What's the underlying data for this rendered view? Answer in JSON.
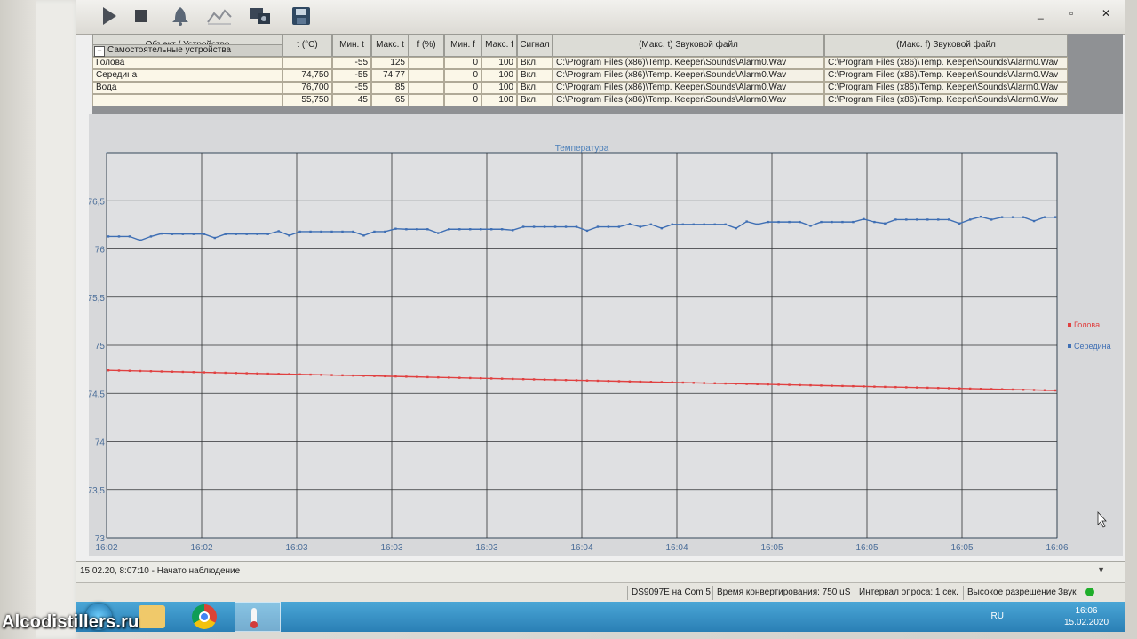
{
  "toolbar": {
    "buttons": [
      {
        "name": "play-icon"
      },
      {
        "name": "stop-icon"
      },
      {
        "name": "bell-icon"
      },
      {
        "name": "chart-icon"
      },
      {
        "name": "devices-icon"
      },
      {
        "name": "save-icon"
      }
    ],
    "window_controls": [
      "_",
      "▫",
      "✕"
    ]
  },
  "table": {
    "group_label": "Самостоятельные устройства",
    "headers": {
      "object": "Объект / Устройство",
      "t": "t (°C)",
      "min_t": "Мин. t",
      "max_t": "Макс. t",
      "f": "f (%)",
      "min_f": "Мин. f",
      "max_f": "Макс. f",
      "signal": "Сигнал",
      "sound_t": "(Макс. t) Звуковой файл",
      "sound_f": "(Макс. f) Звуковой файл"
    },
    "rows": [
      {
        "name": "Голова",
        "t": "",
        "min_t": "-55",
        "max_t": "125",
        "f": "",
        "min_f": "0",
        "max_f": "100",
        "signal": "Вкл.",
        "sound_t": "C:\\Program Files (x86)\\Temp. Keeper\\Sounds\\Alarm0.Wav",
        "sound_f": "C:\\Program Files (x86)\\Temp. Keeper\\Sounds\\Alarm0.Wav"
      },
      {
        "name": "Середина",
        "t": "74,750",
        "min_t": "-55",
        "max_t": "74,77",
        "f": "",
        "min_f": "0",
        "max_f": "100",
        "signal": "Вкл.",
        "sound_t": "C:\\Program Files (x86)\\Temp. Keeper\\Sounds\\Alarm0.Wav",
        "sound_f": "C:\\Program Files (x86)\\Temp. Keeper\\Sounds\\Alarm0.Wav"
      },
      {
        "name": "Вода",
        "t": "76,700",
        "min_t": "-55",
        "max_t": "85",
        "f": "",
        "min_f": "0",
        "max_f": "100",
        "signal": "Вкл.",
        "sound_t": "C:\\Program Files (x86)\\Temp. Keeper\\Sounds\\Alarm0.Wav",
        "sound_f": "C:\\Program Files (x86)\\Temp. Keeper\\Sounds\\Alarm0.Wav"
      },
      {
        "name": "",
        "t": "55,750",
        "min_t": "45",
        "max_t": "65",
        "f": "",
        "min_f": "0",
        "max_f": "100",
        "signal": "Вкл.",
        "sound_t": "C:\\Program Files (x86)\\Temp. Keeper\\Sounds\\Alarm0.Wav",
        "sound_f": "C:\\Program Files (x86)\\Temp. Keeper\\Sounds\\Alarm0.Wav"
      }
    ]
  },
  "chart_data": {
    "type": "line",
    "title": "Температура",
    "ylim": [
      73,
      77
    ],
    "yticks": [
      "73",
      "73,5",
      "74",
      "74,5",
      "75",
      "75,5",
      "76",
      "76,5"
    ],
    "xticks": [
      "16:02",
      "16:02",
      "16:03",
      "16:03",
      "16:03",
      "16:04",
      "16:04",
      "16:05",
      "16:05",
      "16:05",
      "16:06"
    ],
    "grid": true,
    "legend_placement": "right",
    "series": [
      {
        "name": "Голова",
        "color": "#e04040",
        "start": 74.74,
        "end": 74.53
      },
      {
        "name": "Середина",
        "color": "#3f6fb4",
        "start": 76.13,
        "end": 76.33
      }
    ]
  },
  "status": {
    "log": "15.02.20, 8:07:10 - Начато наблюдение",
    "device": "DS9097E на Com 5",
    "conversion": "Время конвертирования: 750 uS",
    "interval": "Интервал опроса: 1 сек.",
    "resolution": "Высокое разрешение",
    "sound": "Звук"
  },
  "taskbar": {
    "tray_lang": "RU",
    "time": "16:06",
    "date": "15.02.2020"
  },
  "watermark": "Alcodistillers.ru"
}
